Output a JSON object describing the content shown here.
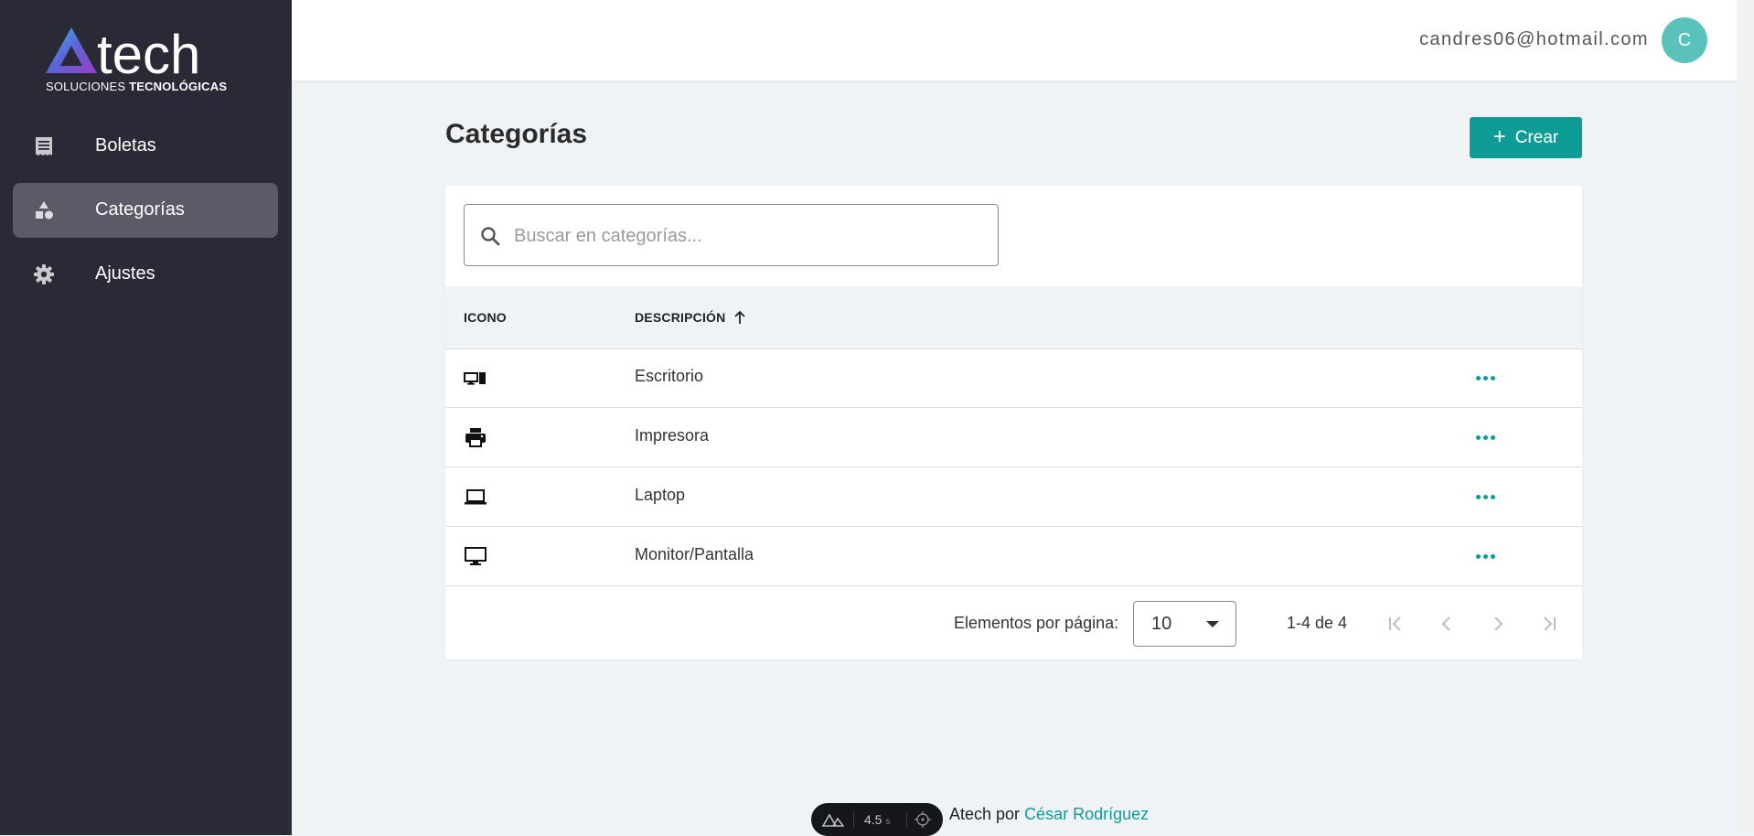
{
  "brand": {
    "name": "Atech",
    "tagline_light": "SOLUCIONES",
    "tagline_bold": "TECNOLÓGICAS"
  },
  "sidebar": {
    "items": [
      {
        "label": "Boletas",
        "icon": "receipt-icon",
        "active": false
      },
      {
        "label": "Categorías",
        "icon": "shapes-icon",
        "active": true
      },
      {
        "label": "Ajustes",
        "icon": "gear-icon",
        "active": false
      }
    ]
  },
  "header": {
    "user_email": "candres06@hotmail.com",
    "avatar_initial": "C"
  },
  "main": {
    "title": "Categorías",
    "create_label": "Crear",
    "search": {
      "placeholder": "Buscar en categorías...",
      "value": ""
    },
    "table": {
      "columns": [
        "ICONO",
        "DESCRIPCIÓN"
      ],
      "sort_column": "DESCRIPCIÓN",
      "sort_direction": "ascending",
      "rows": [
        {
          "icon": "desktop-tower-icon",
          "description": "Escritorio"
        },
        {
          "icon": "printer-icon",
          "description": "Impresora"
        },
        {
          "icon": "laptop-icon",
          "description": "Laptop"
        },
        {
          "icon": "monitor-icon",
          "description": "Monitor/Pantalla"
        }
      ]
    },
    "paginator": {
      "items_per_page_label": "Elementos por página:",
      "items_per_page": "10",
      "range": "1-4 de 4"
    }
  },
  "footer": {
    "text": "Atech por",
    "author": "César Rodríguez"
  },
  "devtool": {
    "time": "4.5",
    "unit": "s"
  },
  "colors": {
    "accent": "#0f9c97",
    "sidebar_bg": "#292a36",
    "sidebar_active": "#5a5b66",
    "avatar": "#5ac2bb",
    "page_bg": "#eff3f6"
  }
}
